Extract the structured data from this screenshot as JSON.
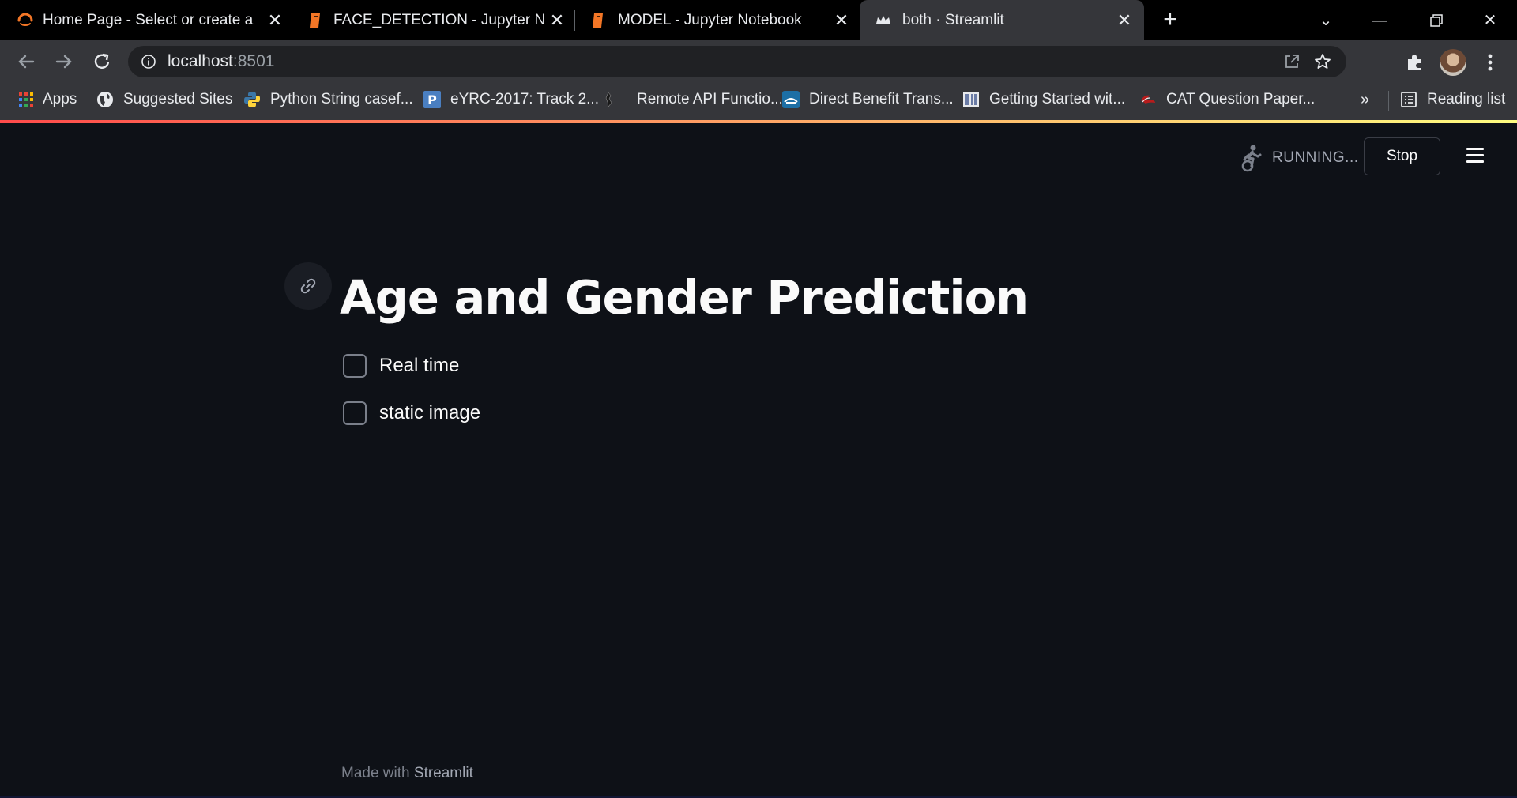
{
  "browser": {
    "tabs": [
      {
        "title": "Home Page - Select or create a notebook",
        "icon": "jupyter-spinner-icon",
        "active": false
      },
      {
        "title": "FACE_DETECTION - Jupyter Notebook",
        "icon": "jupyter-notebook-icon",
        "active": false
      },
      {
        "title": "MODEL - Jupyter Notebook",
        "icon": "jupyter-notebook-icon",
        "active": false
      },
      {
        "title": "both · Streamlit",
        "icon": "streamlit-crown-icon",
        "active": true
      }
    ],
    "address": {
      "host": "localhost",
      "port": ":8501"
    },
    "bookmarks": [
      {
        "label": "Apps",
        "icon": "apps-grid-icon"
      },
      {
        "label": "Suggested Sites",
        "icon": "globe-icon"
      },
      {
        "label": "Python String casef...",
        "icon": "python-icon"
      },
      {
        "label": "eYRC-2017: Track 2...",
        "icon": "p-badge-icon"
      },
      {
        "label": "Remote API Functio...",
        "icon": "robot-icon"
      },
      {
        "label": "Direct Benefit Trans...",
        "icon": "dbt-icon"
      },
      {
        "label": "Getting Started wit...",
        "icon": "book-icon"
      },
      {
        "label": "CAT Question Paper...",
        "icon": "cat-icon"
      }
    ],
    "overflow_label": "»",
    "reading_list": "Reading list"
  },
  "app": {
    "status": "RUNNING...",
    "stop_label": "Stop",
    "title": "Age and Gender Prediction",
    "checkboxes": [
      {
        "label": "Real time",
        "checked": false
      },
      {
        "label": "static image",
        "checked": false
      }
    ],
    "footer": {
      "prefix": "Made with",
      "brand": "Streamlit"
    }
  },
  "colors": {
    "background": "#0e1117",
    "text": "#fafafa",
    "accent_gradient_start": "#ff4b4b",
    "accent_gradient_end": "#fffd80"
  }
}
